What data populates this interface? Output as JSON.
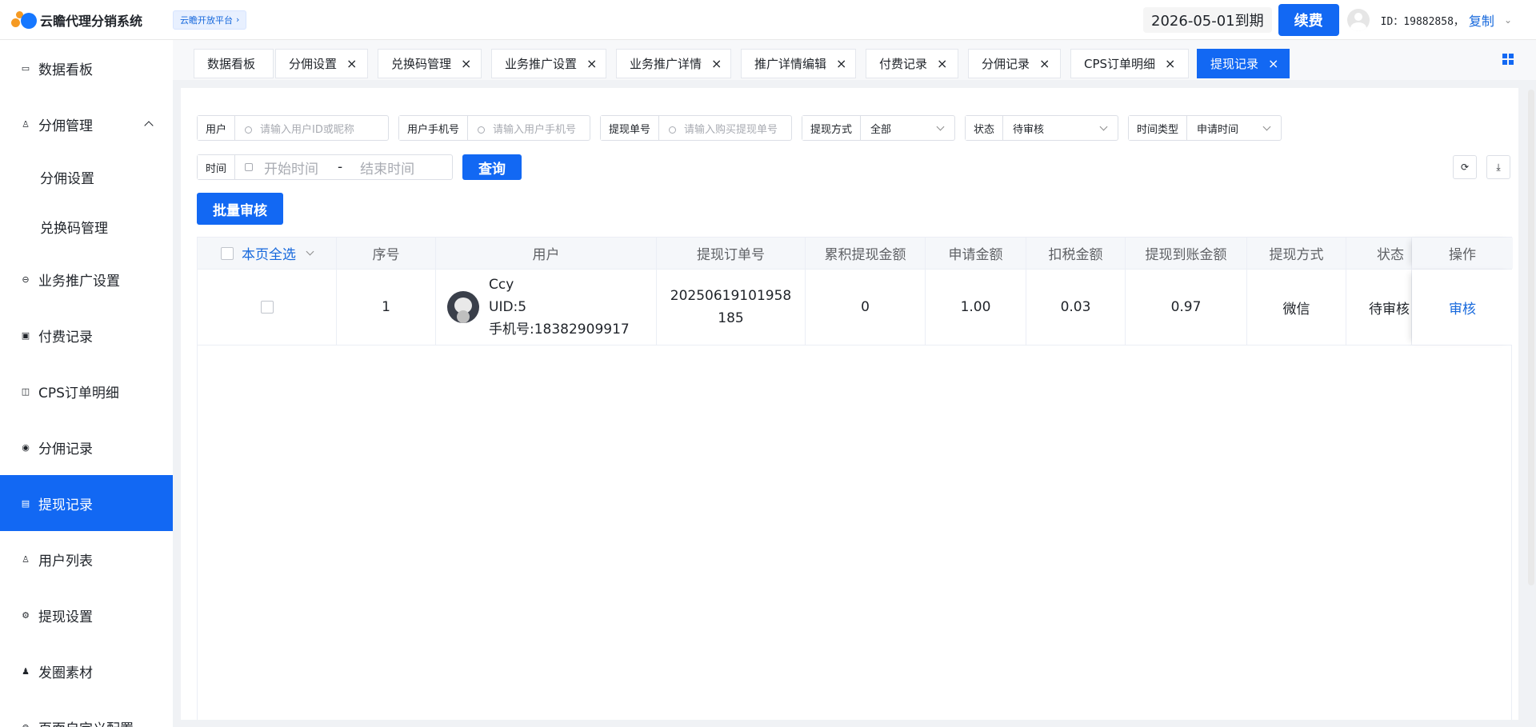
{
  "header": {
    "app_title": "云瞻代理分销系统",
    "platform_link": "云瞻开放平台",
    "expire_text": "2026-05-01到期",
    "renew_label": "续费",
    "id_label": "ID：19882858，",
    "copy_label": "复制"
  },
  "sidebar": {
    "items": [
      {
        "label": "数据看板"
      },
      {
        "label": "分佣管理"
      },
      {
        "label": "分佣设置"
      },
      {
        "label": "兑换码管理"
      },
      {
        "label": "业务推广设置"
      },
      {
        "label": "付费记录"
      },
      {
        "label": "CPS订单明细"
      },
      {
        "label": "分佣记录"
      },
      {
        "label": "提现记录"
      },
      {
        "label": "用户列表"
      },
      {
        "label": "提现设置"
      },
      {
        "label": "发圈素材"
      },
      {
        "label": "页面自定义配置"
      }
    ]
  },
  "tabs": [
    {
      "label": "数据看板"
    },
    {
      "label": "分佣设置"
    },
    {
      "label": "兑换码管理"
    },
    {
      "label": "业务推广设置"
    },
    {
      "label": "业务推广详情"
    },
    {
      "label": "推广详情编辑"
    },
    {
      "label": "付费记录"
    },
    {
      "label": "分佣记录"
    },
    {
      "label": "CPS订单明细"
    },
    {
      "label": "提现记录"
    }
  ],
  "filters": {
    "user_label": "用户",
    "user_placeholder": "请输入用户ID或昵称",
    "phone_label": "用户手机号",
    "phone_placeholder": "请输入用户手机号",
    "order_label": "提现单号",
    "order_placeholder": "请输入购买提现单号",
    "method_label": "提现方式",
    "method_value": "全部",
    "status_label": "状态",
    "status_value": "待审核",
    "time_type_label": "时间类型",
    "time_type_value": "申请时间",
    "time_label": "时间",
    "start_placeholder": "开始时间",
    "range_separator": "-",
    "end_placeholder": "结束时间",
    "query_label": "查询"
  },
  "batch_label": "批量审核",
  "table": {
    "headers": {
      "select_all": "本页全选",
      "index": "序号",
      "user": "用户",
      "order_no": "提现订单号",
      "total_withdrawn": "累积提现金额",
      "apply_amount": "申请金额",
      "tax": "扣税金额",
      "received": "提现到账金额",
      "method": "提现方式",
      "status": "状态",
      "action": "操作"
    },
    "rows": [
      {
        "index": "1",
        "name": "Ccy",
        "uid": "UID:5",
        "phone": "手机号:18382909917",
        "order_no": "20250619101958185",
        "total_withdrawn": "0",
        "apply_amount": "1.00",
        "tax": "0.03",
        "received": "0.97",
        "method": "微信",
        "status": "待审核",
        "action": "审核"
      }
    ]
  }
}
